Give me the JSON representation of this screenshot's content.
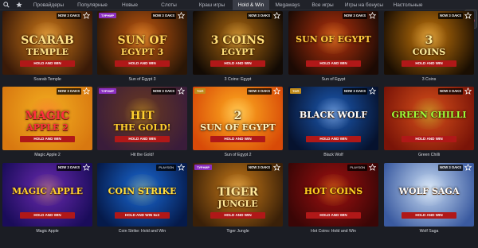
{
  "nav": {
    "tabs": [
      {
        "label": "Провайдеры",
        "active": false
      },
      {
        "label": "Популярные",
        "active": false
      },
      {
        "label": "Новые",
        "active": false
      },
      {
        "label": "Слоты",
        "active": false
      },
      {
        "label": "Краш игры",
        "active": false
      },
      {
        "label": "Hold & Win",
        "active": true
      },
      {
        "label": "Megaways",
        "active": false
      },
      {
        "label": "Все игры",
        "active": false
      },
      {
        "label": "Игры на бонусы",
        "active": false
      },
      {
        "label": "Настольные",
        "active": false
      }
    ],
    "search_icon": "search-icon",
    "favorites_icon": "star-icon"
  },
  "games": [
    {
      "name": "Scarab Temple",
      "badge": "NOW 3 OAKS",
      "tag": "",
      "art": [
        "SCARAB",
        "TEMPLE",
        "HOLD AND WIN"
      ],
      "bg": [
        "#3a1a08",
        "#d07a18"
      ],
      "ink": "#ffe38a"
    },
    {
      "name": "Sun of Egypt 3",
      "badge": "NOW 3 OAKS",
      "tag": "ТУРНИР",
      "art": [
        "SUN OF",
        "EGYPT 3",
        "HOLD AND WIN"
      ],
      "bg": [
        "#2a1606",
        "#c85a10"
      ],
      "ink": "#ffd45a"
    },
    {
      "name": "3 Coins: Egypt",
      "badge": "NOW 3 OAKS",
      "tag": "",
      "art": [
        "3 COINS",
        "EGYPT",
        "HOLD AND WIN"
      ],
      "bg": [
        "#120a04",
        "#b06a10"
      ],
      "ink": "#ffe07a"
    },
    {
      "name": "Sun of Egypt",
      "badge": "NOW 3 OAKS",
      "tag": "",
      "art": [
        "SUN OF EGYPT",
        "",
        "HOLD AND WIN"
      ],
      "bg": [
        "#1c0a04",
        "#b8320c"
      ],
      "ink": "#ffcc40"
    },
    {
      "name": "3 Coins",
      "badge": "NOW 3 OAKS",
      "tag": "",
      "art": [
        "3",
        "COINS",
        "HOLD AND WIN"
      ],
      "bg": [
        "#1a0e02",
        "#c9780a"
      ],
      "ink": "#fff0a0"
    },
    {
      "name": "Magic Apple 2",
      "badge": "NOW 3 OAKS",
      "tag": "",
      "art": [
        "MAGIC",
        "APPLE 2",
        "HOLD AND WIN"
      ],
      "bg": [
        "#d87810",
        "#f4b020"
      ],
      "ink": "#ff2f3f"
    },
    {
      "name": "Hit the Gold!",
      "badge": "NOW 3 OAKS",
      "tag": "ТУРНИР",
      "art": [
        "HIT",
        "THE GOLD!",
        "HOLD AND WIN"
      ],
      "bg": [
        "#3a1c3a",
        "#6a3a20"
      ],
      "ink": "#ffd030"
    },
    {
      "name": "Sun of Egypt 2",
      "badge": "NOW 3 OAKS",
      "tag": "ТОП",
      "art": [
        "2",
        "SUN OF EGYPT",
        "HOLD AND WIN"
      ],
      "bg": [
        "#d84a08",
        "#ffb020"
      ],
      "ink": "#fff4c0"
    },
    {
      "name": "Black Wolf",
      "badge": "NOW 3 OAKS",
      "tag": "ТОП",
      "art": [
        "BLACK WOLF",
        "",
        "HOLD AND WIN"
      ],
      "bg": [
        "#06122e",
        "#1c5cb8"
      ],
      "ink": "#ffffff"
    },
    {
      "name": "Green Chilli",
      "badge": "NOW 3 OAKS",
      "tag": "",
      "art": [
        "GREEN CHILLI",
        "",
        "HOLD AND WIN"
      ],
      "bg": [
        "#7a1408",
        "#d8501a"
      ],
      "ink": "#9cff3a"
    },
    {
      "name": "Magic Apple",
      "badge": "NOW 3 OAKS",
      "tag": "",
      "art": [
        "MAGIC APPLE",
        "",
        "HOLD AND WIN"
      ],
      "bg": [
        "#1a0c5a",
        "#6a2ab0"
      ],
      "ink": "#ffd030"
    },
    {
      "name": "Coin Strike: Hold and Win",
      "badge": "PLAYSON",
      "tag": "",
      "art": [
        "COIN STRIKE",
        "",
        "HOLD AND WIN 5x3"
      ],
      "bg": [
        "#051a4a",
        "#1a6ad8"
      ],
      "ink": "#ffe040"
    },
    {
      "name": "Tiger Jungle",
      "badge": "NOW 3 OAKS",
      "tag": "ТУРНИР",
      "art": [
        "TIGER",
        "JUNGLE",
        "HOLD AND WIN"
      ],
      "bg": [
        "#3a2008",
        "#c87a18"
      ],
      "ink": "#ffe89a"
    },
    {
      "name": "Hot Coins: Hold and Win",
      "badge": "PLAYSON",
      "tag": "",
      "art": [
        "HOT COINS",
        "",
        "HOLD AND WIN"
      ],
      "bg": [
        "#3a0606",
        "#a01010"
      ],
      "ink": "#ffd020"
    },
    {
      "name": "Wolf Saga",
      "badge": "NOW 3 OAKS",
      "tag": "",
      "art": [
        "WOLF SAGA",
        "",
        "HOLD AND WIN"
      ],
      "bg": [
        "#3a5aa0",
        "#c8dcf4"
      ],
      "ink": "#ffffff"
    }
  ]
}
